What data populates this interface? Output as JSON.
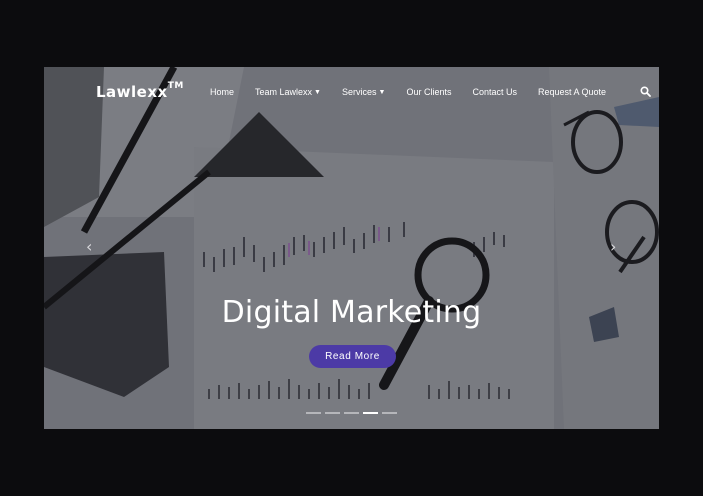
{
  "brand": {
    "name": "Lawlexx",
    "tm": "TM"
  },
  "nav": {
    "items": [
      {
        "label": "Home",
        "has_caret": false
      },
      {
        "label": "Team Lawlexx",
        "has_caret": true
      },
      {
        "label": "Services",
        "has_caret": true
      },
      {
        "label": "Our Clients",
        "has_caret": false
      },
      {
        "label": "Contact Us",
        "has_caret": false
      },
      {
        "label": "Request A Quote",
        "has_caret": false
      }
    ],
    "search_icon": "search-icon"
  },
  "hero": {
    "headline": "Digital Marketing",
    "cta_label": "Read More",
    "cta_color": "#4c3aa6",
    "prev_icon": "chevron-left-icon",
    "next_icon": "chevron-right-icon",
    "slides_total": 5,
    "active_slide": 4
  },
  "colors": {
    "page_bg": "#0c0c0e",
    "overlay": "#6c6e74"
  }
}
